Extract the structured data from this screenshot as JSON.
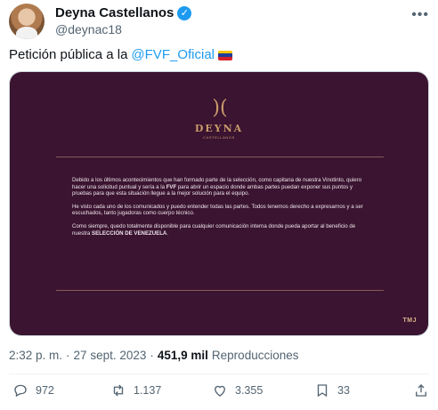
{
  "author": {
    "name": "Deyna Castellanos",
    "handle": "@deynac18",
    "verified": true
  },
  "tweet": {
    "text_prefix": "Petición pública a la",
    "mention": "@FVF_Oficial",
    "emoji": "venezuela-flag"
  },
  "media": {
    "logo_word": "DEYNA",
    "logo_sub": "CASTELLANOS",
    "paragraph1_a": "Debido a los últimos acontecimientos que han formado parte de la selección, como capitana de nuestra Vinotinto, quiero hacer una solicitud puntual y sería a la ",
    "paragraph1_bold": "FVF",
    "paragraph1_b": " para abrir un espacio donde ambas partes puedan exponer sus puntos y pruebas para que esta situación llegue a la mejor solución para el equipo.",
    "paragraph2": "He visto cada uno de los comunicados y puedo entender todas las partes. Todos tenemos derecho a expresarnos y a ser escuchados, tanto jugadoras como cuerpo técnico.",
    "paragraph3_a": "Como siempre, quedo totalmente disponible para cualquier comunicación interna donde pueda aportar al beneficio de nuestra ",
    "paragraph3_bold": "SELECCIÓN DE VENEZUELA",
    "paragraph3_b": ".",
    "brand": "TMJ",
    "colors": {
      "background": "#3a1430",
      "gold": "#c99a6a"
    }
  },
  "meta": {
    "time": "2:32 p. m.",
    "separator": "·",
    "date": "27 sept. 2023",
    "separator2": "·",
    "views_count": "451,9 mil",
    "views_label": "Reproducciones"
  },
  "actions": {
    "replies": "972",
    "reposts": "1.137",
    "likes": "3.355",
    "bookmarks": "33"
  },
  "colors": {
    "accent": "#1d9bf0",
    "muted": "#536471"
  }
}
